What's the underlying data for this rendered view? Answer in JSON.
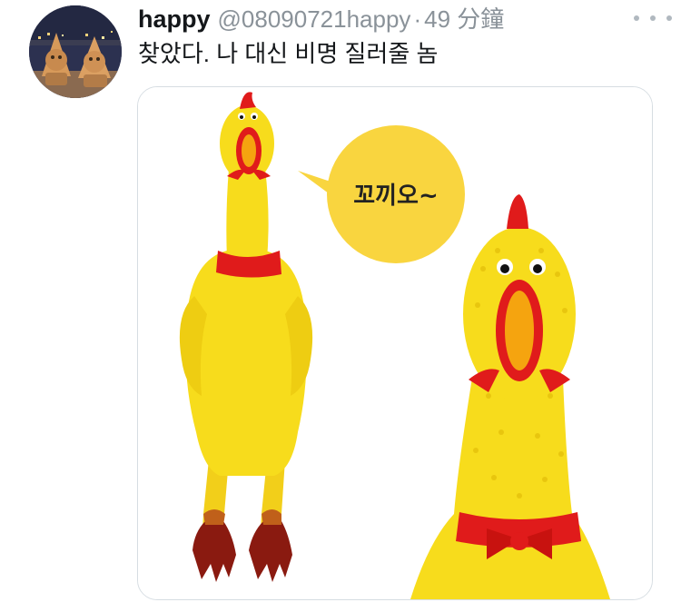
{
  "tweet": {
    "display_name": "happy",
    "handle": "@08090721happy",
    "separator": "·",
    "time": "49 分鐘",
    "text": "찾았다. 나 대신 비명 질러줄 놈",
    "more_icon": "more-horizontal-icon"
  },
  "media": {
    "speech_bubble_text": "꼬끼오~"
  },
  "colors": {
    "name": "#14171a",
    "muted": "#8a9299",
    "border": "#d6dde2",
    "chicken_yellow": "#f7dc1c",
    "bubble_yellow": "#f9d53f",
    "comb_red": "#e01b1b"
  }
}
